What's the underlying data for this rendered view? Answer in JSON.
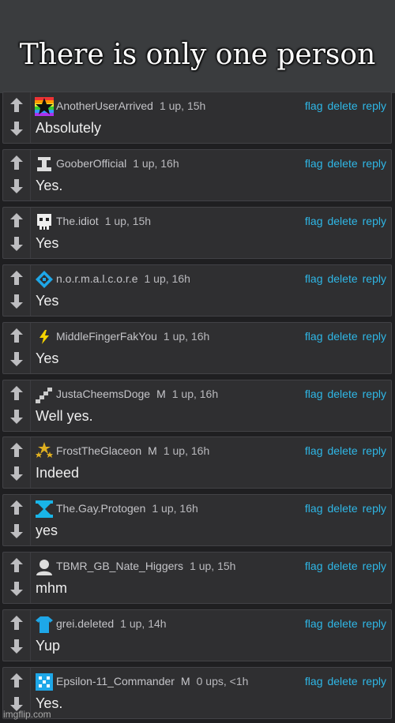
{
  "banner": {
    "title": "There is only one person"
  },
  "actions": {
    "flag": "flag",
    "delete": "delete",
    "reply": "reply"
  },
  "comments": [
    {
      "user": "AnotherUserArrived",
      "badge": "",
      "score": "1 up, 15h",
      "text": "Absolutely",
      "avatar": "rainbow-star-icon"
    },
    {
      "user": "GooberOfficial",
      "badge": "",
      "score": "1 up, 16h",
      "text": "Yes.",
      "avatar": "pixel-figure-icon"
    },
    {
      "user": "The.idiot",
      "badge": "",
      "score": "1 up, 15h",
      "text": "Yes",
      "avatar": "pixel-skull-icon"
    },
    {
      "user": "n.o.r.m.a.l.c.o.r.e",
      "badge": "",
      "score": "1 up, 16h",
      "text": "Yes",
      "avatar": "blue-diamond-icon"
    },
    {
      "user": "MiddleFingerFakYou",
      "badge": "",
      "score": "1 up, 16h",
      "text": "Yes",
      "avatar": "lightning-icon"
    },
    {
      "user": "JustaCheemsDoge",
      "badge": "M",
      "score": "1 up, 16h",
      "text": "Well yes.",
      "avatar": "pixel-stairs-icon"
    },
    {
      "user": "FrostTheGlaceon",
      "badge": "M",
      "score": "1 up, 16h",
      "text": "Indeed",
      "avatar": "gold-stars-icon"
    },
    {
      "user": "The.Gay.Protogen",
      "badge": "",
      "score": "1 up, 16h",
      "text": "yes",
      "avatar": "blue-hourglass-icon"
    },
    {
      "user": "TBMR_GB_Nate_Higgers",
      "badge": "",
      "score": "1 up, 15h",
      "text": "mhm",
      "avatar": "default-user-icon"
    },
    {
      "user": "grei.deleted",
      "badge": "",
      "score": "1 up, 14h",
      "text": "Yup",
      "avatar": "blue-shirt-icon"
    },
    {
      "user": "Epsilon-11_Commander",
      "badge": "M",
      "score": "0 ups, <1h",
      "text": "Yes.",
      "avatar": "blue-checker-icon"
    }
  ],
  "watermark": "imgflip.com",
  "colors": {
    "link": "#2fb7e6",
    "panel": "#2f2f31",
    "background": "#1f1f21"
  }
}
